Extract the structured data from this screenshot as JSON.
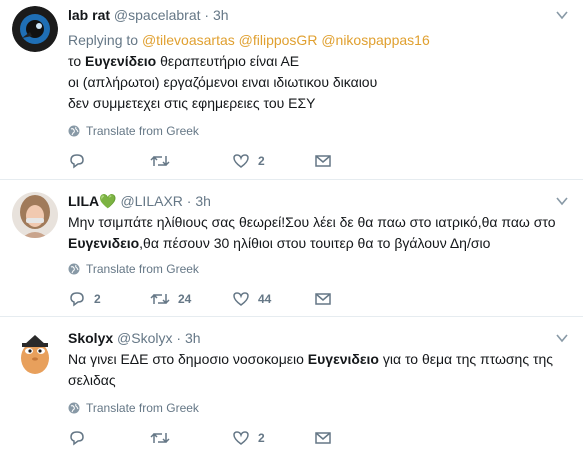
{
  "tweets": [
    {
      "name": "lab rat",
      "handle": "@spacelabrat",
      "dot": "·",
      "time": "3h",
      "replying_prefix": "Replying to",
      "mentions": [
        "@tilevoasartas",
        "@filipposGR",
        "@nikospappas16"
      ],
      "lines": [
        [
          "το ",
          "Ευγενίδειο",
          " θεραπευτήριο είναι ΑΕ"
        ],
        [
          "οι (απλήρωτοι) εργαζόμενοι ειναι ιδιωτικου δικαιου"
        ],
        [
          "δεν συμμετεχει στις εφημερειες του ΕΣΥ"
        ]
      ],
      "translate": "Translate from Greek",
      "reply_count": "",
      "retweet_count": "",
      "like_count": "2",
      "avatar_icon": "lab-rat-dark-circle-logo"
    },
    {
      "name": "LILA",
      "name_emoji": "💚",
      "handle": "@LILAXR",
      "dot": "·",
      "time": "3h",
      "lines": [
        [
          "Μην τσιμπάτε ηλίθιους σας θεωρεί!Σου λέει δε θα παω στο ιατρικό,θα παω στο"
        ],
        [
          "",
          "Ευγενιδειο",
          ",θα πέσουν 30 ηλίθιοι στου τουιτερ θα το βγάλουν Δη/σιο"
        ]
      ],
      "translate": "Translate from Greek",
      "reply_count": "2",
      "retweet_count": "24",
      "like_count": "44",
      "avatar_icon": "woman-photo-avatar"
    },
    {
      "name": "Skolyx",
      "handle": "@Skolyx",
      "dot": "·",
      "time": "3h",
      "lines": [
        [
          "Να γινει ΕΔΕ στο δημοσιο νοσοκομειο ",
          "Ευγενιδειο",
          " για το θεμα της πτωσης της"
        ],
        [
          "σελιδας"
        ]
      ],
      "translate": "Translate from Greek",
      "reply_count": "",
      "retweet_count": "",
      "like_count": "2",
      "avatar_icon": "egg-with-graduation-cap-avatar"
    }
  ],
  "colors": {
    "text": "#14171a",
    "secondary": "#657786",
    "mention": "#e0a030",
    "divider": "#e6ecf0",
    "heart_emoji": "#77b255"
  }
}
